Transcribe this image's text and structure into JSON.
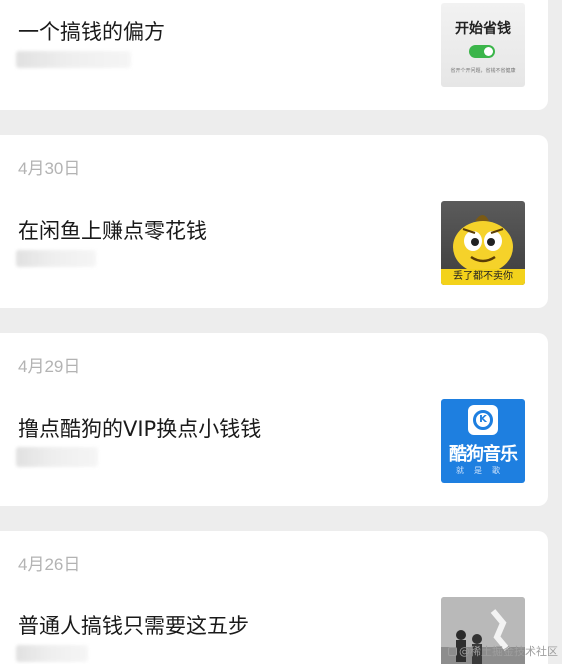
{
  "feed": {
    "items": [
      {
        "date": "",
        "title": "一个搞钱的偏方",
        "thumbnail": {
          "headline": "开始省钱",
          "caption": "省开个开问题，省钱不省健康",
          "toggle_color": "#3bb54a"
        }
      },
      {
        "date": "4月30日",
        "title": "在闲鱼上赚点零花钱",
        "thumbnail": {
          "banner": "丢了都不卖你",
          "banner_color": "#f3d21b"
        }
      },
      {
        "date": "4月29日",
        "title": "撸点酷狗的VIP换点小钱钱",
        "thumbnail": {
          "logo_letter": "K",
          "name": "酷狗音乐",
          "tagline": "就是歌",
          "brand_color": "#1e7fe0"
        }
      },
      {
        "date": "4月26日",
        "title": "普通人搞钱只需要这五步",
        "thumbnail": {}
      }
    ]
  },
  "watermark": "@稀土掘金技术社区"
}
